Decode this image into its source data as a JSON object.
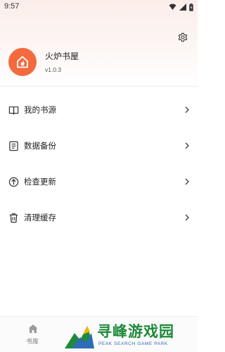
{
  "status_bar": {
    "time": "9:57"
  },
  "profile": {
    "app_name": "火炉书屋",
    "version": "v1.0.3"
  },
  "menu": {
    "items": [
      {
        "label": "我的书源",
        "icon": "book-source-icon"
      },
      {
        "label": "数据备份",
        "icon": "backup-icon"
      },
      {
        "label": "检查更新",
        "icon": "update-icon"
      },
      {
        "label": "清理缓存",
        "icon": "trash-icon"
      }
    ]
  },
  "bottom_nav": {
    "items": [
      {
        "label": "书库",
        "icon": "home-icon"
      }
    ]
  },
  "watermark": {
    "title": "寻峰游戏园",
    "subtitle": "PEAK SEARCH GAME PARK"
  },
  "colors": {
    "accent": "#f26a3e",
    "watermark_green": "#1e8a3a",
    "watermark_blue": "#2e6bb8"
  }
}
